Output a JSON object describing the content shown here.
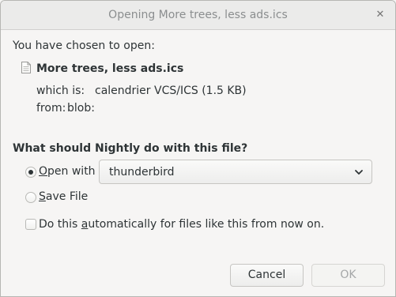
{
  "window": {
    "title": "Opening More trees, less ads.ics",
    "close_glyph": "✕"
  },
  "intro": {
    "chosen_label": "You have chosen to open:",
    "file_name": "More trees, less ads.ics",
    "which_is_label": "which is:",
    "which_is_value": "calendrier VCS/ICS (1.5 KB)",
    "from_label": "from:",
    "from_value": "blob:"
  },
  "action": {
    "question": "What should Nightly do with this file?",
    "open_with": {
      "pre": "",
      "mnemonic": "O",
      "post": "pen with",
      "selected": true
    },
    "application": {
      "value": "thunderbird",
      "icon": "chevron-down-icon"
    },
    "save_file": {
      "pre": "",
      "mnemonic": "S",
      "post": "ave File",
      "selected": false
    },
    "auto": {
      "pre": "Do this ",
      "mnemonic": "a",
      "post": "utomatically for files like this from now on.",
      "checked": false
    }
  },
  "buttons": {
    "cancel": "Cancel",
    "ok": "OK",
    "ok_enabled": false
  },
  "icons": {
    "file": "file-icon",
    "close": "close-icon"
  }
}
